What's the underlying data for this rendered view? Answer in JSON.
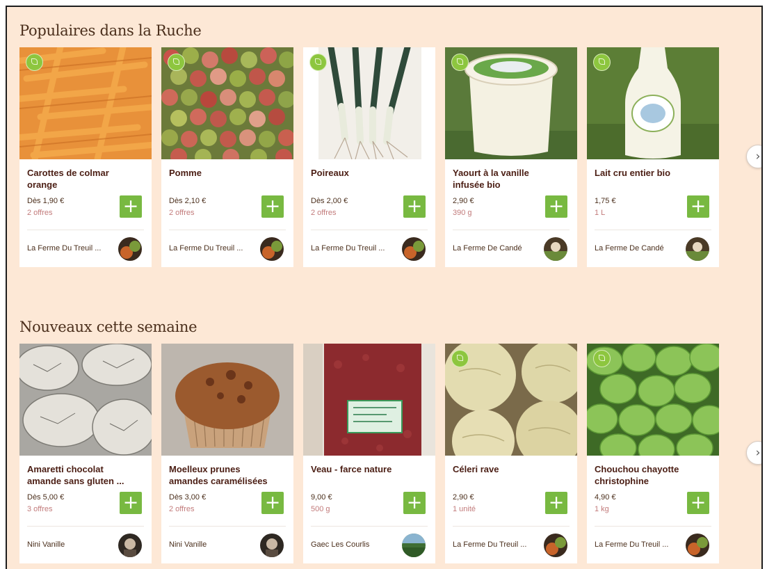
{
  "sections": [
    {
      "title": "Populaires dans la Ruche",
      "products": [
        {
          "name": "Carottes de colmar\norange",
          "price": "Dès 1,90 €",
          "detail": "2 offres",
          "producer": "La Ferme Du Treuil ...",
          "bio": true
        },
        {
          "name": "Pomme",
          "price": "Dès 2,10 €",
          "detail": "2 offres",
          "producer": "La Ferme Du Treuil ...",
          "bio": true
        },
        {
          "name": "Poireaux",
          "price": "Dès 2,00 €",
          "detail": "2 offres",
          "producer": "La Ferme Du Treuil ...",
          "bio": true
        },
        {
          "name": "Yaourt à la vanille\ninfusée bio",
          "price": "2,90 €",
          "detail": "390 g",
          "producer": "La Ferme De Candé",
          "bio": true
        },
        {
          "name": "Lait cru entier bio",
          "price": "1,75 €",
          "detail": "1 L",
          "producer": "La Ferme De Candé",
          "bio": true
        }
      ]
    },
    {
      "title": "Nouveaux cette semaine",
      "products": [
        {
          "name": "Amaretti chocolat\namande sans gluten ...",
          "price": "Dès 5,00 €",
          "detail": "3 offres",
          "producer": "Nini Vanille",
          "bio": false
        },
        {
          "name": "Moelleux prunes\namandes caramélisées",
          "price": "Dès 3,00 €",
          "detail": "2 offres",
          "producer": "Nini Vanille",
          "bio": false
        },
        {
          "name": "Veau - farce nature",
          "price": "9,00 €",
          "detail": "500 g",
          "producer": "Gaec Les Courlis",
          "bio": false
        },
        {
          "name": "Céleri rave",
          "price": "2,90 €",
          "detail": "1 unité",
          "producer": "La Ferme Du Treuil ...",
          "bio": true
        },
        {
          "name": "Chouchou chayotte\nchristophine",
          "price": "4,90 €",
          "detail": "1 kg",
          "producer": "La Ferme Du Treuil ...",
          "bio": true
        }
      ]
    }
  ],
  "add_button_label": "+",
  "next_button_label": "›",
  "colors": {
    "page_background": "#fde8d6",
    "add_button": "#78b941",
    "product_name": "#4b1e14",
    "offer_text": "#c27b7b",
    "bio_badge": "#8dc63f"
  },
  "icons": {
    "add": "plus-icon",
    "next": "chevron-right-icon",
    "bio": "leaf-icon"
  }
}
